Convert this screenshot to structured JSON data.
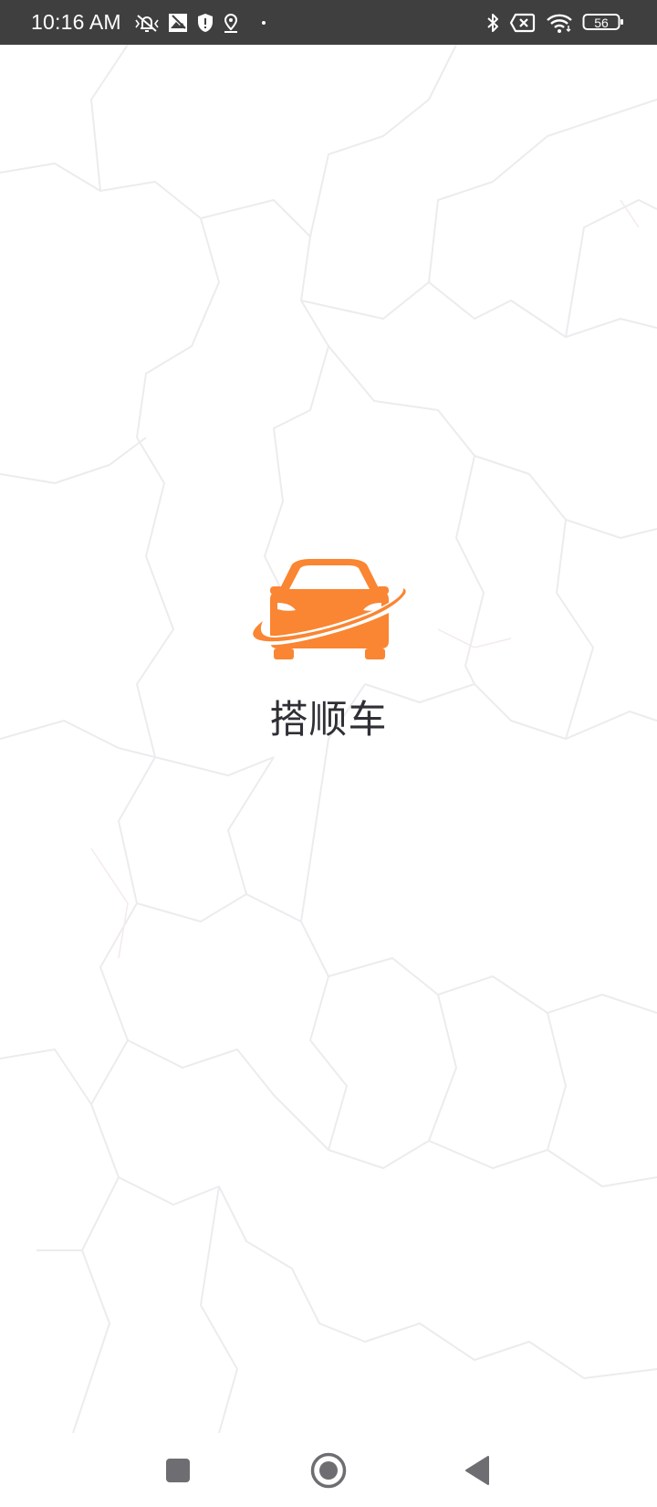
{
  "status_bar": {
    "time": "10:16 AM",
    "battery_level": "56",
    "left_icons": [
      "mute-vibrate-icon",
      "photo-icon",
      "shield-icon",
      "location-icon",
      "dot-icon"
    ],
    "right_icons": [
      "bluetooth-icon",
      "no-sim-icon",
      "wifi-icon",
      "battery-icon"
    ]
  },
  "splash": {
    "logo": "car-logo-icon",
    "app_name": "搭顺车",
    "brand_color": "#FA8532"
  },
  "nav_bar": {
    "buttons": [
      "recent-apps-button",
      "home-button",
      "back-button"
    ]
  },
  "colors": {
    "status_bar_bg": "#3F3F3F",
    "text_dark": "#2F2F35",
    "nav_icon": "#6E6E72"
  }
}
